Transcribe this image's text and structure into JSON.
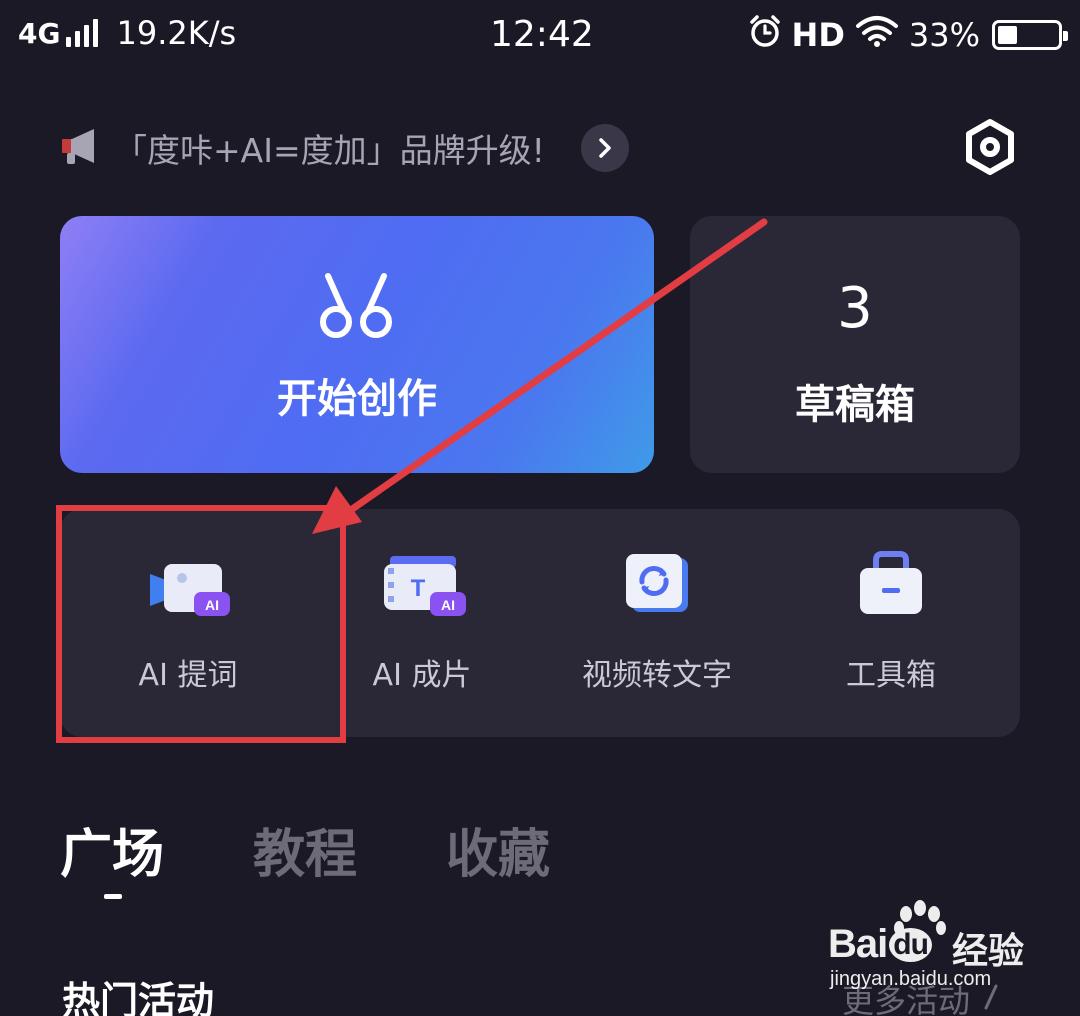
{
  "status_bar": {
    "network": "4G",
    "speed": "19.2K/s",
    "time": "12:42",
    "hd": "HD",
    "battery_percent": "33%",
    "battery_level": 0.33
  },
  "announcement": {
    "text": "「度咔+AI=度加」品牌升级!",
    "icon": "megaphone-icon",
    "arrow_icon": "chevron-right-icon"
  },
  "header": {
    "settings_icon": "settings-hexagon-icon"
  },
  "cards": {
    "create": {
      "label": "开始创作",
      "icon": "scissors-icon"
    },
    "drafts": {
      "count": "3",
      "label": "草稿箱"
    }
  },
  "tools": [
    {
      "label": "AI 提词",
      "icon": "ai-teleprompter-icon"
    },
    {
      "label": "AI 成片",
      "icon": "ai-video-icon"
    },
    {
      "label": "视频转文字",
      "icon": "video-to-text-icon"
    },
    {
      "label": "工具箱",
      "icon": "toolbox-icon"
    }
  ],
  "tabs": [
    {
      "label": "广场",
      "active": true
    },
    {
      "label": "教程",
      "active": false
    },
    {
      "label": "收藏",
      "active": false
    }
  ],
  "section": {
    "title": "热门活动",
    "more": "更多活动"
  },
  "watermark": {
    "brand": "Bai",
    "brand_du": "du",
    "brand_cn": "经验",
    "url": "jingyan.baidu.com"
  },
  "colors": {
    "background": "#1b1925",
    "card": "#2a2836",
    "highlight": "#e23d43",
    "accent_start": "#8f7ff5",
    "accent_end": "#3f9be8"
  }
}
